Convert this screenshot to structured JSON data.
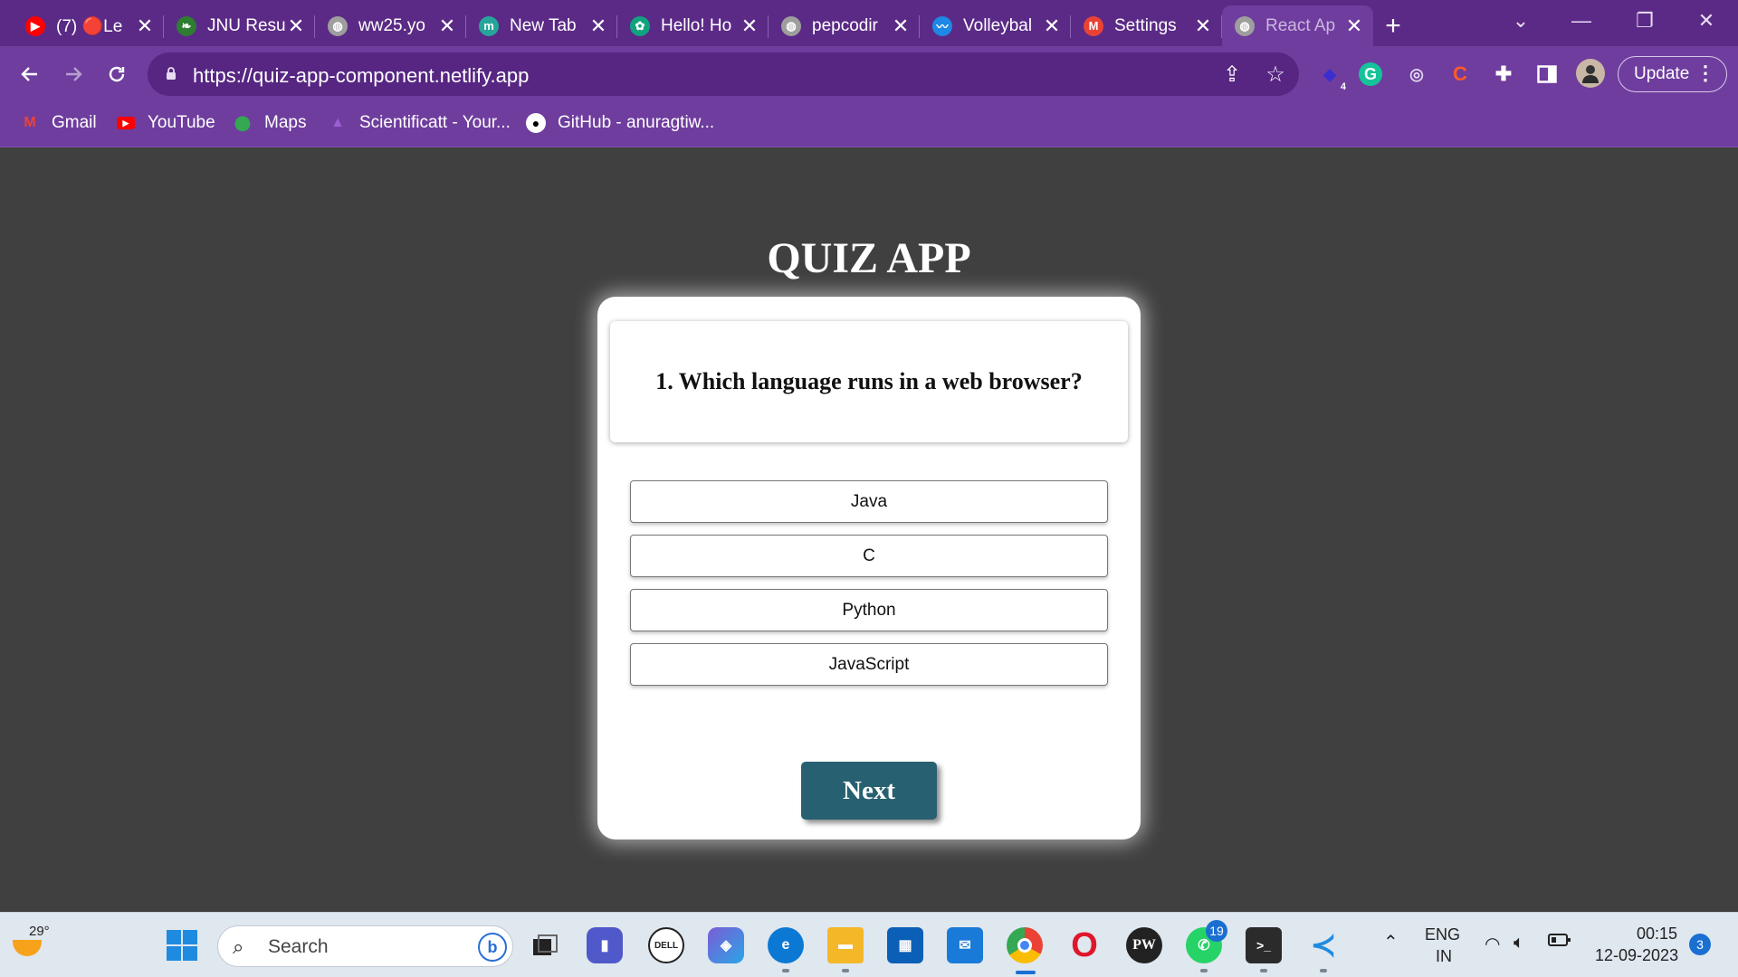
{
  "browser": {
    "tabs": [
      {
        "title": "(7) 🔴Le",
        "favicon": "youtube-icon",
        "color": "#ff0000"
      },
      {
        "title": "JNU Resu",
        "favicon": "leaf-icon",
        "color": "#2e7d32"
      },
      {
        "title": "ww25.yo",
        "favicon": "globe-icon",
        "color": "#9e9e9e"
      },
      {
        "title": "New Tab",
        "favicon": "m-icon",
        "color": "#26a69a"
      },
      {
        "title": "Hello! Ho",
        "favicon": "chatgpt-icon",
        "color": "#10a37f"
      },
      {
        "title": "pepcodir",
        "favicon": "globe-icon",
        "color": "#9e9e9e"
      },
      {
        "title": "Volleybal",
        "favicon": "wave-icon",
        "color": "#1e88e5"
      },
      {
        "title": "Settings",
        "favicon": "gmail-icon",
        "color": "#ea4335"
      },
      {
        "title": "React Ap",
        "favicon": "globe-icon",
        "color": "#9e9e9e",
        "active": true
      }
    ],
    "new_tab": "+",
    "url": "https://quiz-app-component.netlify.app",
    "update_label": "Update",
    "extension_badge": "4",
    "bookmarks": [
      {
        "label": "Gmail",
        "icon": "gmail-icon"
      },
      {
        "label": "YouTube",
        "icon": "youtube-icon"
      },
      {
        "label": "Maps",
        "icon": "maps-icon"
      },
      {
        "label": "Scientificatt - Your...",
        "icon": "scientificatt-icon"
      },
      {
        "label": "GitHub - anuragtiw...",
        "icon": "github-icon"
      }
    ],
    "theme_color": "#6f3d9e"
  },
  "app": {
    "title": "QUIZ APP",
    "question": "1. Which language runs in a web browser?",
    "options": [
      "Java",
      "C",
      "Python",
      "JavaScript"
    ],
    "next_label": "Next",
    "next_color": "#276070",
    "background": "#3f403f"
  },
  "taskbar": {
    "temperature": "29°",
    "search_label": "Search",
    "whatsapp_badge": "19",
    "language_top": "ENG",
    "language_bottom": "IN",
    "time": "00:15",
    "date": "12-09-2023",
    "notification_count": "3"
  }
}
